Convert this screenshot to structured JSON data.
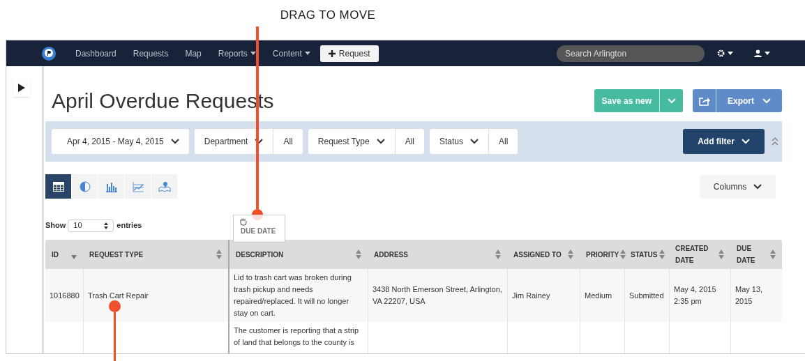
{
  "callouts": [
    {
      "text": "DRAG TO MOVE"
    }
  ],
  "nav": {
    "items": [
      {
        "label": "Dashboard",
        "dropdown": false
      },
      {
        "label": "Requests",
        "dropdown": false
      },
      {
        "label": "Map",
        "dropdown": false
      },
      {
        "label": "Reports",
        "dropdown": true
      },
      {
        "label": "Content",
        "dropdown": true
      }
    ],
    "new_button": "Request",
    "search": {
      "placeholder": "Search Arlington"
    }
  },
  "title": "April Overdue Requests",
  "actions": {
    "save": "Save as new",
    "export": "Export"
  },
  "filters": [
    {
      "label": "Apr 4, 2015 - May 4, 2015"
    },
    {
      "label": "Department",
      "value": "All"
    },
    {
      "label": "Request Type",
      "value": "All"
    },
    {
      "label": "Status",
      "value": "All"
    }
  ],
  "add_filter": "Add filter",
  "views": [
    {
      "kind": "table",
      "selected": true
    },
    {
      "kind": "pie",
      "selected": false
    },
    {
      "kind": "bar",
      "selected": false
    },
    {
      "kind": "line",
      "selected": false
    },
    {
      "kind": "map",
      "selected": false
    }
  ],
  "columns_button": "Columns",
  "entries": {
    "show": "Show",
    "value": "10",
    "suffix": "entries"
  },
  "drag_ghost": "DUE DATE",
  "table": {
    "columns": [
      {
        "label": "ID",
        "sorted": true
      },
      {
        "label": "REQUEST TYPE",
        "sorted": false
      },
      {
        "label": "DESCRIPTION",
        "sorted": false
      },
      {
        "label": "ADDRESS",
        "sorted": false
      },
      {
        "label": "ASSIGNED TO",
        "sorted": false
      },
      {
        "label": "PRIORITY",
        "sorted": false
      },
      {
        "label": "STATUS",
        "sorted": false
      },
      {
        "label": "CREATED DATE",
        "sorted": false
      },
      {
        "label": "DUE DATE",
        "sorted": false
      }
    ],
    "rows": [
      [
        "1016880",
        "Trash Cart Repair",
        "Lid to trash cart was broken during trash pickup and needs repaired/replaced. It will no longer stay on cart.",
        "3438 North Emerson Street, Arlington, VA 22207, USA",
        "Jim Rainey",
        "Medium",
        "Submitted",
        "May 4, 2015 2:35 pm",
        "May 13, 2015"
      ],
      [
        "",
        "",
        "The customer is reporting that a strip of land that belongs to the county is",
        "",
        "",
        "",
        "",
        "",
        ""
      ]
    ]
  }
}
